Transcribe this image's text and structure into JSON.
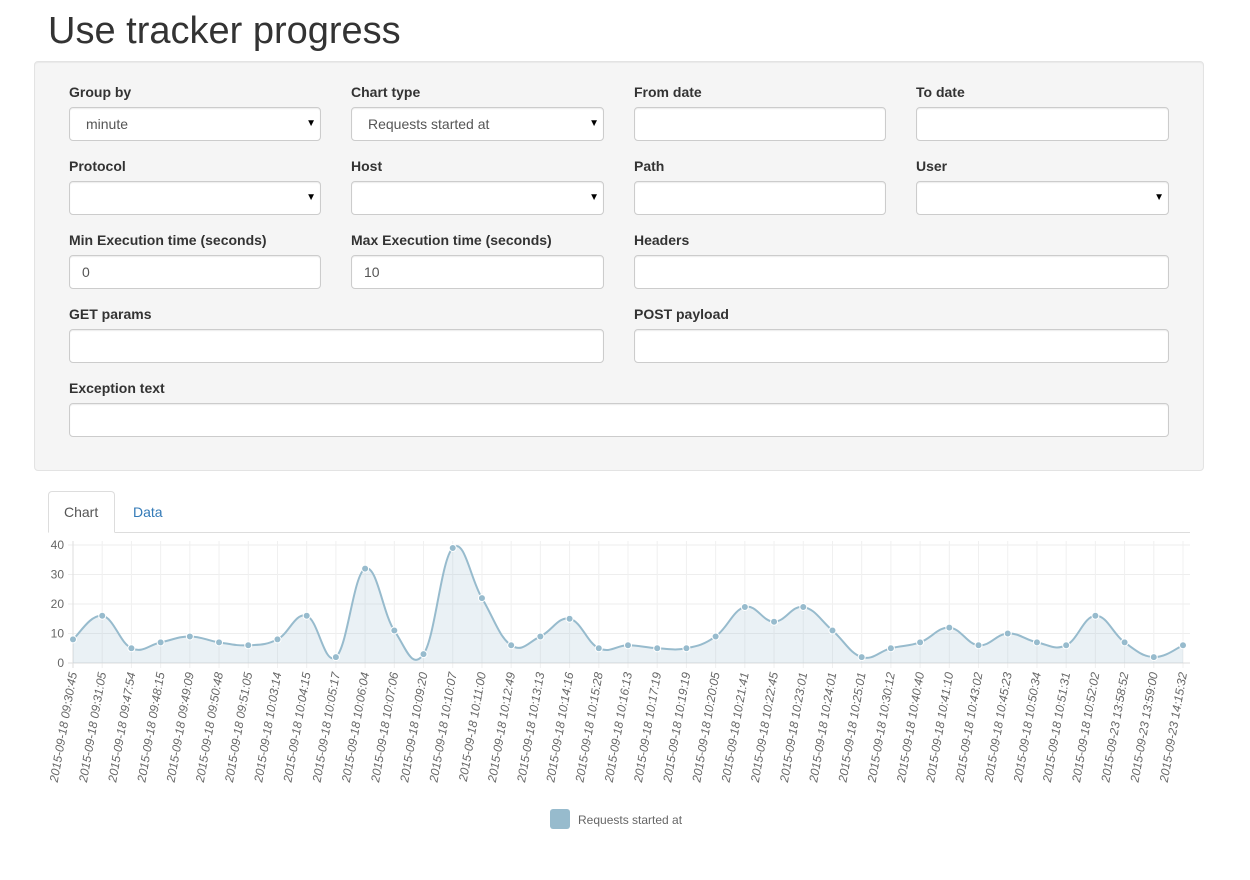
{
  "page": {
    "title": "Use tracker progress"
  },
  "filters": {
    "group_by": {
      "label": "Group by",
      "value": "minute"
    },
    "chart_type": {
      "label": "Chart type",
      "value": "Requests started at"
    },
    "from_date": {
      "label": "From date",
      "value": ""
    },
    "to_date": {
      "label": "To date",
      "value": ""
    },
    "protocol": {
      "label": "Protocol",
      "value": ""
    },
    "host": {
      "label": "Host",
      "value": ""
    },
    "path": {
      "label": "Path",
      "value": ""
    },
    "user": {
      "label": "User",
      "value": ""
    },
    "min_exec": {
      "label": "Min Execution time (seconds)",
      "value": "0"
    },
    "max_exec": {
      "label": "Max Execution time (seconds)",
      "value": "10"
    },
    "headers": {
      "label": "Headers",
      "value": ""
    },
    "get_params": {
      "label": "GET params",
      "value": ""
    },
    "post_payload": {
      "label": "POST payload",
      "value": ""
    },
    "exception_text": {
      "label": "Exception text",
      "value": ""
    }
  },
  "tabs": [
    {
      "label": "Chart",
      "active": true
    },
    {
      "label": "Data",
      "active": false
    }
  ],
  "chart_data": {
    "type": "line",
    "ylim": [
      0,
      40
    ],
    "yticks": [
      0,
      10,
      20,
      30,
      40
    ],
    "grid": true,
    "legend_position": "bottom",
    "categories": [
      "2015-09-18 09:30:45",
      "2015-09-18 09:31:05",
      "2015-09-18 09:47:54",
      "2015-09-18 09:48:15",
      "2015-09-18 09:49:09",
      "2015-09-18 09:50:48",
      "2015-09-18 09:51:05",
      "2015-09-18 10:03:14",
      "2015-09-18 10:04:15",
      "2015-09-18 10:05:17",
      "2015-09-18 10:06:04",
      "2015-09-18 10:07:06",
      "2015-09-18 10:09:20",
      "2015-09-18 10:10:07",
      "2015-09-18 10:11:00",
      "2015-09-18 10:12:49",
      "2015-09-18 10:13:13",
      "2015-09-18 10:14:16",
      "2015-09-18 10:15:28",
      "2015-09-18 10:16:13",
      "2015-09-18 10:17:19",
      "2015-09-18 10:19:19",
      "2015-09-18 10:20:05",
      "2015-09-18 10:21:41",
      "2015-09-18 10:22:45",
      "2015-09-18 10:23:01",
      "2015-09-18 10:24:01",
      "2015-09-18 10:25:01",
      "2015-09-18 10:30:12",
      "2015-09-18 10:40:40",
      "2015-09-18 10:41:10",
      "2015-09-18 10:43:02",
      "2015-09-18 10:45:23",
      "2015-09-18 10:50:34",
      "2015-09-18 10:51:31",
      "2015-09-18 10:52:02",
      "2015-09-23 13:58:52",
      "2015-09-23 13:59:00",
      "2015-09-23 14:15:32"
    ],
    "series": [
      {
        "name": "Requests started at",
        "color": "#97bbcd",
        "values": [
          8,
          16,
          5,
          7,
          9,
          7,
          6,
          8,
          16,
          2,
          32,
          11,
          3,
          39,
          22,
          6,
          9,
          15,
          5,
          6,
          5,
          5,
          9,
          19,
          14,
          19,
          11,
          2,
          5,
          7,
          12,
          6,
          10,
          7,
          6,
          16,
          7,
          2,
          6
        ]
      }
    ]
  }
}
